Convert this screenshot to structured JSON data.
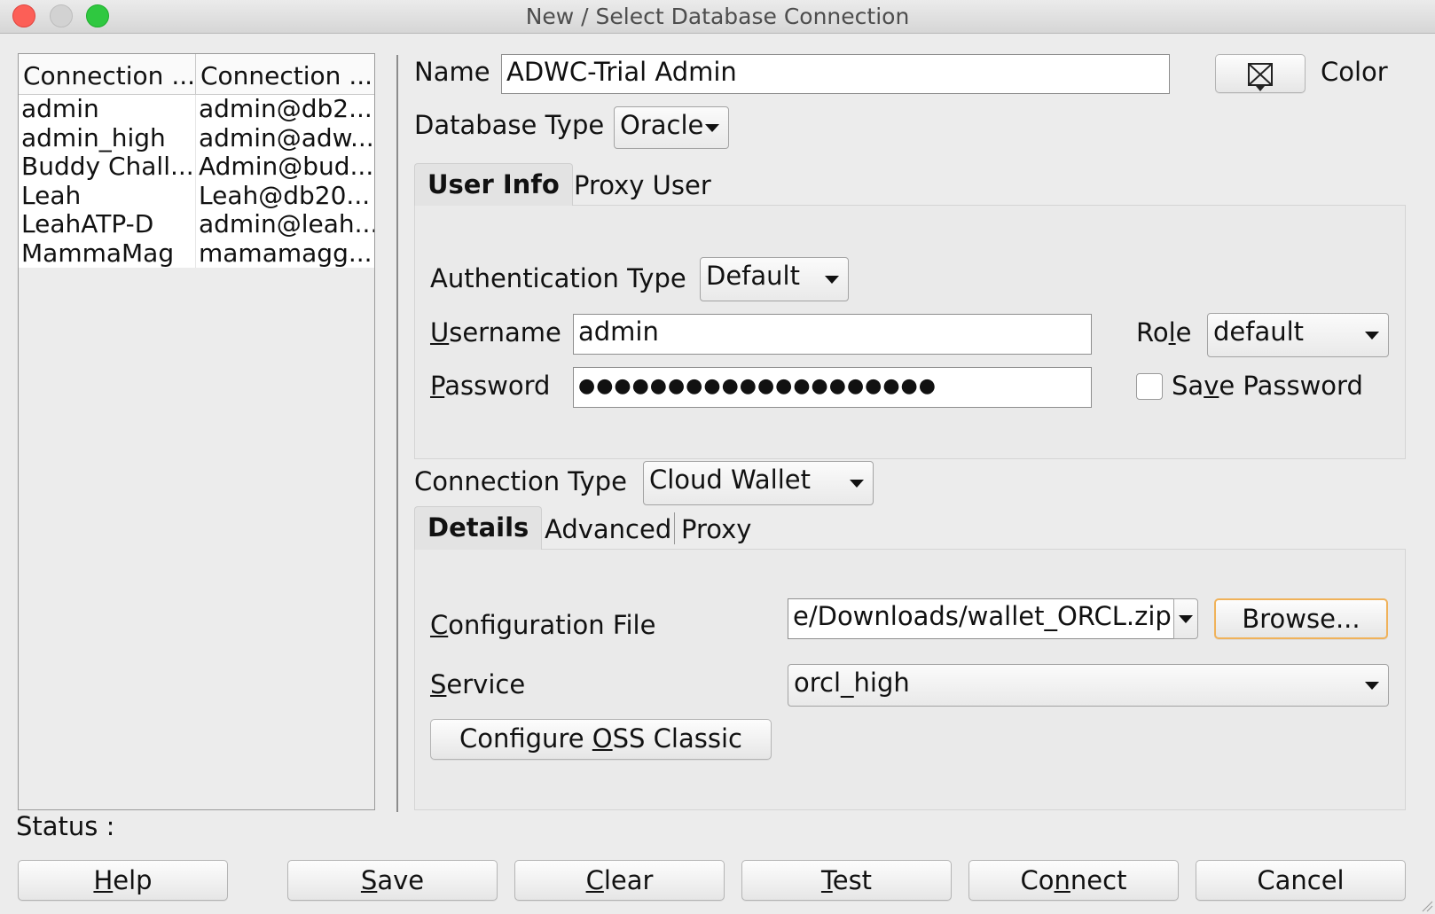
{
  "window": {
    "title": "New / Select Database Connection"
  },
  "connections": {
    "headers": [
      "Connection ...",
      "Connection ..."
    ],
    "rows": [
      [
        "admin",
        "admin@db2..."
      ],
      [
        "admin_high",
        "admin@adw..."
      ],
      [
        "Buddy Chall...",
        "Admin@bud..."
      ],
      [
        "Leah",
        "Leah@db20..."
      ],
      [
        "LeahATP-D",
        "admin@leah..."
      ],
      [
        "MammaMag",
        "mamamagg..."
      ]
    ]
  },
  "form": {
    "name_label": "Name",
    "name_value": "ADWC-Trial Admin",
    "color_label": "Color",
    "db_type_label": "Database Type",
    "db_type_value": "Oracle",
    "tabs_user": [
      "User Info",
      "Proxy User"
    ],
    "auth_type_label": "Authentication Type",
    "auth_type_value": "Default",
    "username_label": {
      "u": "U",
      "rest": "sername"
    },
    "username_value": "admin",
    "role_label": {
      "pre": "Ro",
      "u": "l",
      "post": "e"
    },
    "role_value": "default",
    "password_label": {
      "u": "P",
      "rest": "assword"
    },
    "password_value": "●●●●●●●●●●●●●●●●●●●●",
    "save_password_label": {
      "pre": "Sa",
      "u": "v",
      "post": "e Password"
    },
    "conn_type_label": "Connection Type",
    "conn_type_value": "Cloud Wallet",
    "tabs_conn": [
      "Details",
      "Advanced",
      "Proxy"
    ],
    "config_file_label": {
      "u": "C",
      "rest": "onfiguration File"
    },
    "config_file_value": "e/Downloads/wallet_ORCL.zip",
    "browse_label": "Browse...",
    "service_label": {
      "u": "S",
      "rest": "ervice"
    },
    "service_value": "orcl_high",
    "configure_oss": {
      "pre": "Configure ",
      "u": "O",
      "post": "SS Classic"
    }
  },
  "status": {
    "label": "Status :"
  },
  "buttons": {
    "help": {
      "u": "H",
      "rest": "elp"
    },
    "save": {
      "u": "S",
      "rest": "ave"
    },
    "clear": {
      "u": "C",
      "rest": "lear"
    },
    "test": {
      "u": "T",
      "rest": "est"
    },
    "connect": {
      "pre": "Co",
      "u": "n",
      "post": "nect"
    },
    "cancel": "Cancel"
  }
}
